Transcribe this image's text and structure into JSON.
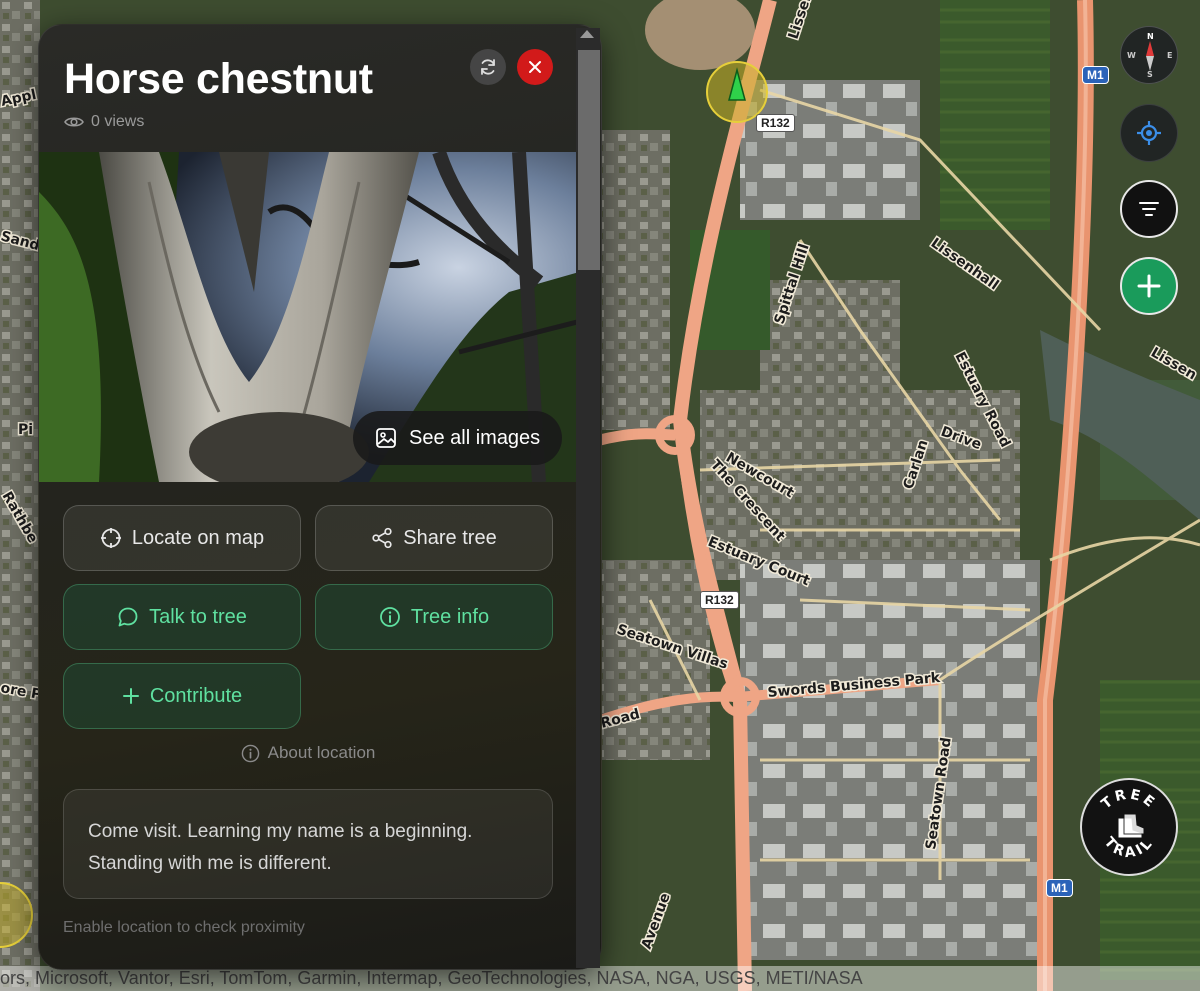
{
  "panel": {
    "title": "Horse chestnut",
    "views": "0 views",
    "see_all_images": "See all images",
    "buttons": {
      "locate": "Locate on map",
      "share": "Share tree",
      "talk": "Talk to tree",
      "info": "Tree info",
      "contribute": "Contribute"
    },
    "about_location": "About location",
    "quote_line1": "Come visit. Learning my name is a beginning.",
    "quote_line2": "Standing with me is different.",
    "enable_location": "Enable location to check proximity"
  },
  "map": {
    "roads": {
      "r132_a": "R132",
      "r132_b": "R132",
      "m1_a": "M1",
      "m1_b": "M1"
    },
    "labels": {
      "lissenhall_gr": "Lissenhall Gr",
      "lissenhall": "Lissenhall",
      "lissen": "Lissen",
      "spittal_hill": "Spittal Hill",
      "estuary_road": "Estuary Road",
      "carlan": "Carlan",
      "drive": "Drive",
      "newcourt": "Newcourt",
      "the_crescent": "The Crescent",
      "estuary_court": "Estuary Court",
      "seatown_villas": "Seatown Villas",
      "swords_business_park": "Swords Business Park",
      "seatown_road": "Seatown Road",
      "road": "Road",
      "avenue": "Avenue",
      "appl": "Appl",
      "sand": "Sand",
      "pi": "Pi",
      "rathbe": "Rathbe",
      "ore_p": "ore P"
    },
    "compass": {
      "n": "N",
      "s": "S",
      "e": "E",
      "w": "W"
    },
    "attribution": "ors, Microsoft, Vantor, Esri, TomTom, Garmin, Intermap, GeoTechnologies, NASA, NGA, USGS, METI/NASA",
    "logo_top": "TREE",
    "logo_bottom": "TRAIL"
  },
  "colors": {
    "accent_green": "#5fe0a0",
    "close_red": "#d21a1a",
    "add_green": "#1a9b5b",
    "road_orange": "#efa585",
    "motorway": "#e9946f"
  },
  "icons": [
    "eye-icon",
    "refresh-icon",
    "close-icon",
    "image-icon",
    "crosshair-icon",
    "share-icon",
    "chat-icon",
    "info-icon",
    "plus-icon",
    "compass-icon",
    "locate-icon",
    "filter-icon",
    "add-icon",
    "tree-marker-icon"
  ]
}
